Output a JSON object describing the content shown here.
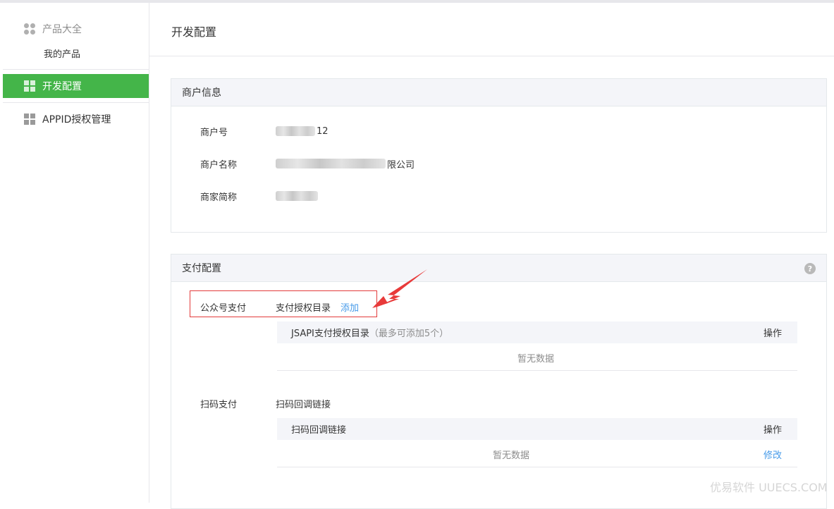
{
  "sidebar": {
    "products_title": "产品大全",
    "my_products": "我的产品",
    "items": [
      {
        "label": "开发配置",
        "active": true
      },
      {
        "label": "APPID授权管理",
        "active": false
      }
    ]
  },
  "page": {
    "title": "开发配置"
  },
  "merchant": {
    "section_title": "商户信息",
    "fields": [
      {
        "label": "商户号",
        "value_suffix": "12"
      },
      {
        "label": "商户名称",
        "value_suffix": "限公司"
      },
      {
        "label": "商家简称",
        "value_suffix": ""
      }
    ]
  },
  "payment": {
    "section_title": "支付配置",
    "help_icon": "?",
    "jsapi": {
      "label": "公众号支付",
      "dir_label": "支付授权目录",
      "add_link": "添加",
      "table": {
        "col_main": "JSAPI支付授权目录",
        "col_hint": "（最多可添加5个）",
        "col_action": "操作",
        "empty": "暂无数据"
      }
    },
    "scan": {
      "label": "扫码支付",
      "dir_label": "扫码回调链接",
      "table": {
        "col_main": "扫码回调链接",
        "col_action": "操作",
        "empty": "暂无数据",
        "edit_link": "修改"
      }
    }
  },
  "watermark": "优易软件 UUECS.COM",
  "colors": {
    "accent": "#44b549",
    "link": "#459ae9",
    "highlight": "#e33b3b"
  }
}
